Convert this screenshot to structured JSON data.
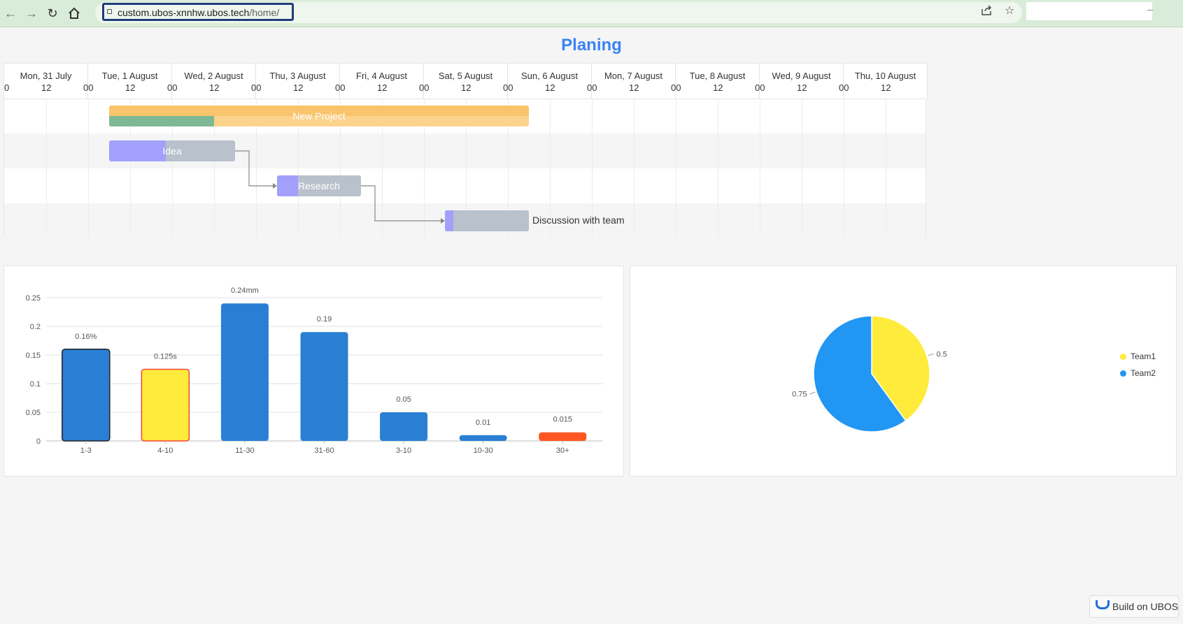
{
  "browser": {
    "url_host": "custom.ubos-xnnhw.ubos.tech",
    "url_path": "/home/"
  },
  "page": {
    "title": "Planing"
  },
  "gantt": {
    "days": [
      "Mon, 31 July",
      "Tue, 1 August",
      "Wed, 2 August",
      "Thu, 3 August",
      "Fri, 4 August",
      "Sat, 5 August",
      "Sun, 6 August",
      "Mon, 7 August",
      "Tue, 8 August",
      "Wed, 9 August",
      "Thu, 10 August"
    ],
    "hour_labels": [
      "0",
      "12",
      "00",
      "12",
      "00",
      "12",
      "00",
      "12",
      "00",
      "12",
      "00",
      "12",
      "00",
      "12",
      "00",
      "12",
      "00",
      "12",
      "00",
      "12",
      "00",
      "12"
    ],
    "tasks": [
      {
        "name": "New Project",
        "start": "2023-08-01 06:00",
        "end": "2023-08-06 06:00",
        "progress": 0.25,
        "color": "#f9c46b",
        "progress_color": "#7fb894",
        "type": "project"
      },
      {
        "name": "Idea",
        "start": "2023-08-01 06:00",
        "end": "2023-08-02 18:00",
        "progress": 0.45,
        "color": "#b8c1cc",
        "progress_color": "#a2a0fb",
        "type": "task"
      },
      {
        "name": "Research",
        "start": "2023-08-03 06:00",
        "end": "2023-08-04 06:00",
        "progress": 0.25,
        "color": "#b8c1cc",
        "progress_color": "#a2a0fb",
        "type": "task"
      },
      {
        "name": "Discussion with team",
        "start": "2023-08-05 06:00",
        "end": "2023-08-06 06:00",
        "progress": 0.1,
        "color": "#b8c1cc",
        "progress_color": "#a2a0fb",
        "type": "task"
      }
    ]
  },
  "chart_data": [
    {
      "type": "bar",
      "categories": [
        "1-3",
        "4-10",
        "11-30",
        "31-60",
        "3-10",
        "10-30",
        "30+"
      ],
      "values": [
        0.16,
        0.125,
        0.24,
        0.19,
        0.05,
        0.01,
        0.015
      ],
      "data_labels": [
        "0.16%",
        "0.125s",
        "0.24mm",
        "0.19",
        "0.05",
        "0.01",
        "0.015"
      ],
      "bar_colors": [
        "#2a7fd4",
        "#ffeb3b",
        "#2a7fd4",
        "#2a7fd4",
        "#2a7fd4",
        "#2a7fd4",
        "#ff5722"
      ],
      "bar_borders": [
        "#222222",
        "#f44336",
        "none",
        "none",
        "none",
        "none",
        "none"
      ],
      "ylim": [
        0,
        0.25
      ],
      "yticks": [
        "0",
        "0.05",
        "0.1",
        "0.15",
        "0.2",
        "0.25"
      ],
      "grid": true
    },
    {
      "type": "pie",
      "labels": [
        "Team1",
        "Team2"
      ],
      "values": [
        0.5,
        0.75
      ],
      "value_labels": [
        "0.5",
        "0.75"
      ],
      "colors": [
        "#ffeb3b",
        "#2196f3"
      ],
      "legend": "right"
    }
  ],
  "badge": {
    "label": "Build on UBOS"
  }
}
